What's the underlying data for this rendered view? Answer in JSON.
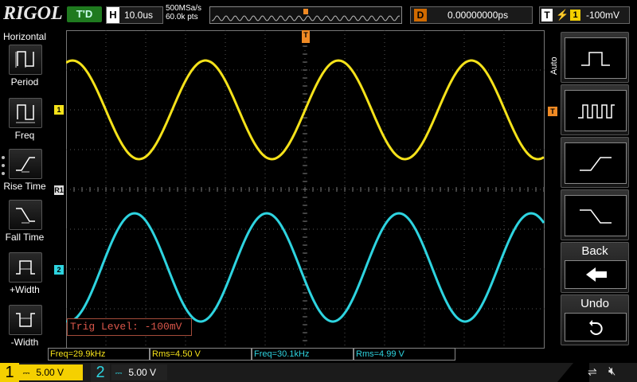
{
  "top": {
    "brand": "RIGOL",
    "run_state": "T'D",
    "horizontal_label": "H",
    "timebase": "10.0us",
    "sample_rate": "500MSa/s",
    "memory_depth": "60.0k pts",
    "delay_label": "D",
    "delay_value": "0.00000000ps",
    "trigger_label": "T",
    "trigger_edge_icon": "rising-edge-icon",
    "trigger_source": "1",
    "trigger_level": "-100mV"
  },
  "left_menu": {
    "title": "Horizontal",
    "items": [
      {
        "label": "Period",
        "icon": "period-icon"
      },
      {
        "label": "Freq",
        "icon": "frequency-icon"
      },
      {
        "label": "Rise Time",
        "icon": "rise-time-icon"
      },
      {
        "label": "Fall Time",
        "icon": "fall-time-icon"
      },
      {
        "label": "+Width",
        "icon": "positive-width-icon"
      },
      {
        "label": "-Width",
        "icon": "negative-width-icon"
      }
    ]
  },
  "right_menu": {
    "mode_label": "Auto",
    "items": [
      {
        "icon": "single-pulse-icon"
      },
      {
        "icon": "pulse-train-icon"
      },
      {
        "icon": "rising-edge-icon"
      },
      {
        "icon": "falling-edge-icon"
      }
    ],
    "back_label": "Back",
    "back_icon": "arrow-left-icon",
    "undo_label": "Undo",
    "undo_icon": "undo-icon"
  },
  "markers": {
    "ch1": "1",
    "ch2": "2",
    "ref": "R1",
    "trigger_pos": "T",
    "trigger_level": "T"
  },
  "trig_level_popup": "Trig Level: -100mV",
  "measurements": [
    {
      "text": "Freq=29.9kHz",
      "channel": 1
    },
    {
      "text": "Rms=4.50 V",
      "channel": 1
    },
    {
      "text": "Freq=30.1kHz",
      "channel": 2
    },
    {
      "text": "Rms=4.99 V",
      "channel": 2
    }
  ],
  "channels": [
    {
      "number": "1",
      "coupling_icon": "dc-coupling-icon",
      "scale": "5.00 V",
      "color": "#f5e21a"
    },
    {
      "number": "2",
      "coupling_icon": "dc-coupling-icon",
      "scale": "5.00 V",
      "color": "#2ed4e0"
    }
  ],
  "status_icons": [
    "usb-icon",
    "speaker-mute-icon"
  ],
  "colors": {
    "ch1": "#f5e21a",
    "ch2": "#2ed4e0",
    "trigger": "#f08a24",
    "run_badge": "#1f7a1f"
  }
}
